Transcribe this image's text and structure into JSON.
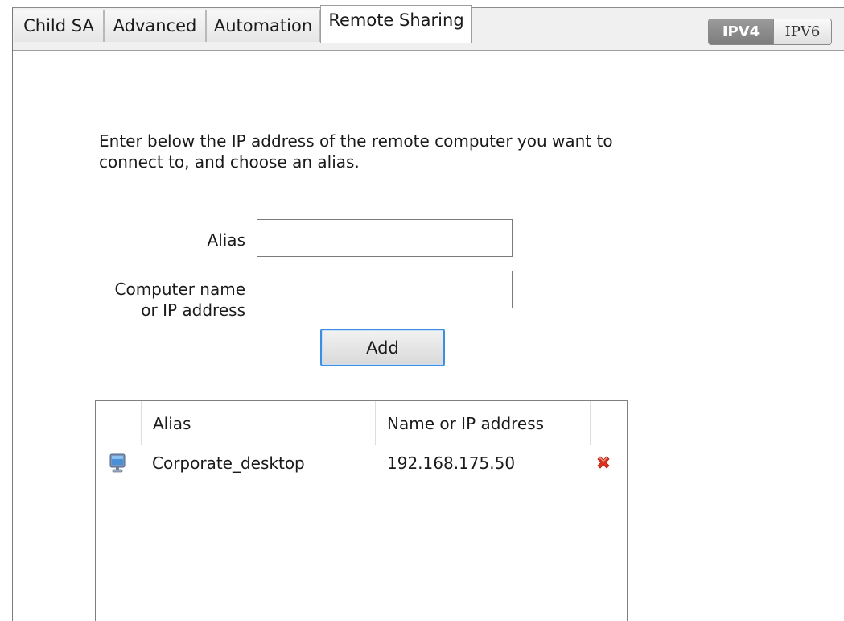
{
  "tabs": [
    {
      "label": "Child SA",
      "active": false
    },
    {
      "label": "Advanced",
      "active": false
    },
    {
      "label": "Automation",
      "active": false
    },
    {
      "label": "Remote Sharing",
      "active": true
    }
  ],
  "ip_version": {
    "options": [
      "IPV4",
      "IPV6"
    ],
    "selected": "IPV4"
  },
  "remote_sharing": {
    "instructions": "Enter below the IP address of the remote computer you want to connect to, and choose an alias.",
    "alias_label": "Alias",
    "alias_value": "",
    "address_label_line1": "Computer name",
    "address_label_line2": "or IP address",
    "address_value": "",
    "add_button_label": "Add",
    "list": {
      "columns": [
        "Alias",
        "Name or IP address"
      ],
      "rows": [
        {
          "icon": "monitor-icon",
          "alias": "Corporate_desktop",
          "address": "192.168.175.50",
          "action_icon": "delete-icon"
        }
      ]
    }
  },
  "colors": {
    "accent_focus": "#3d8ee0",
    "delete_red": "#e0301e",
    "toggle_active": "#8a8a8a"
  }
}
